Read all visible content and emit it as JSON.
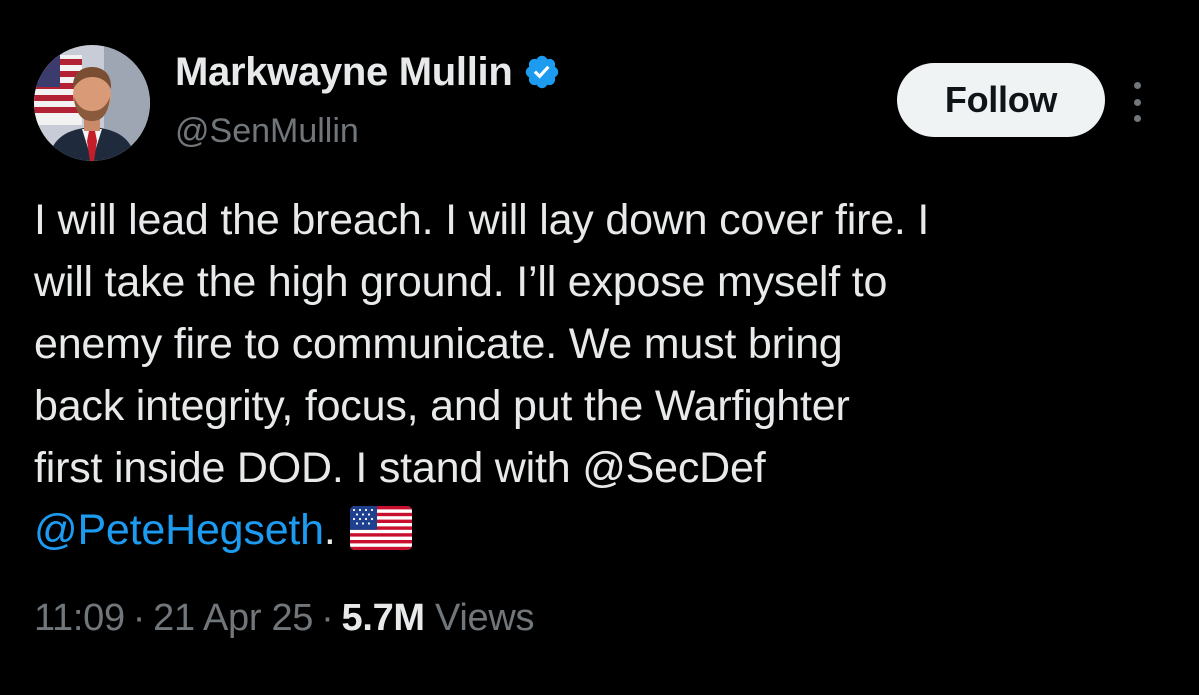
{
  "author": {
    "display_name": "Markwayne Mullin",
    "handle": "@SenMullin",
    "verified": true,
    "verified_color": "#1d9bf0"
  },
  "actions": {
    "follow_label": "Follow",
    "more_icon": "more-vertical-icon"
  },
  "tweet": {
    "lines": [
      "I will lead the breach. I will lay down cover fire. I",
      "will take the high ground. I’ll expose myself to",
      "enemy fire to communicate. We must bring",
      "back integrity, focus, and put the Warfighter",
      "first inside DOD. I stand with @SecDef"
    ],
    "last_mention": "@PeteHegseth",
    "last_punct": ".",
    "emoji": "us-flag-emoji",
    "mention_color": "#1d9bf0"
  },
  "meta": {
    "time": "11:09",
    "separator": "·",
    "date": "21 Apr 25",
    "views_count": "5.7M",
    "views_label": "Views"
  }
}
